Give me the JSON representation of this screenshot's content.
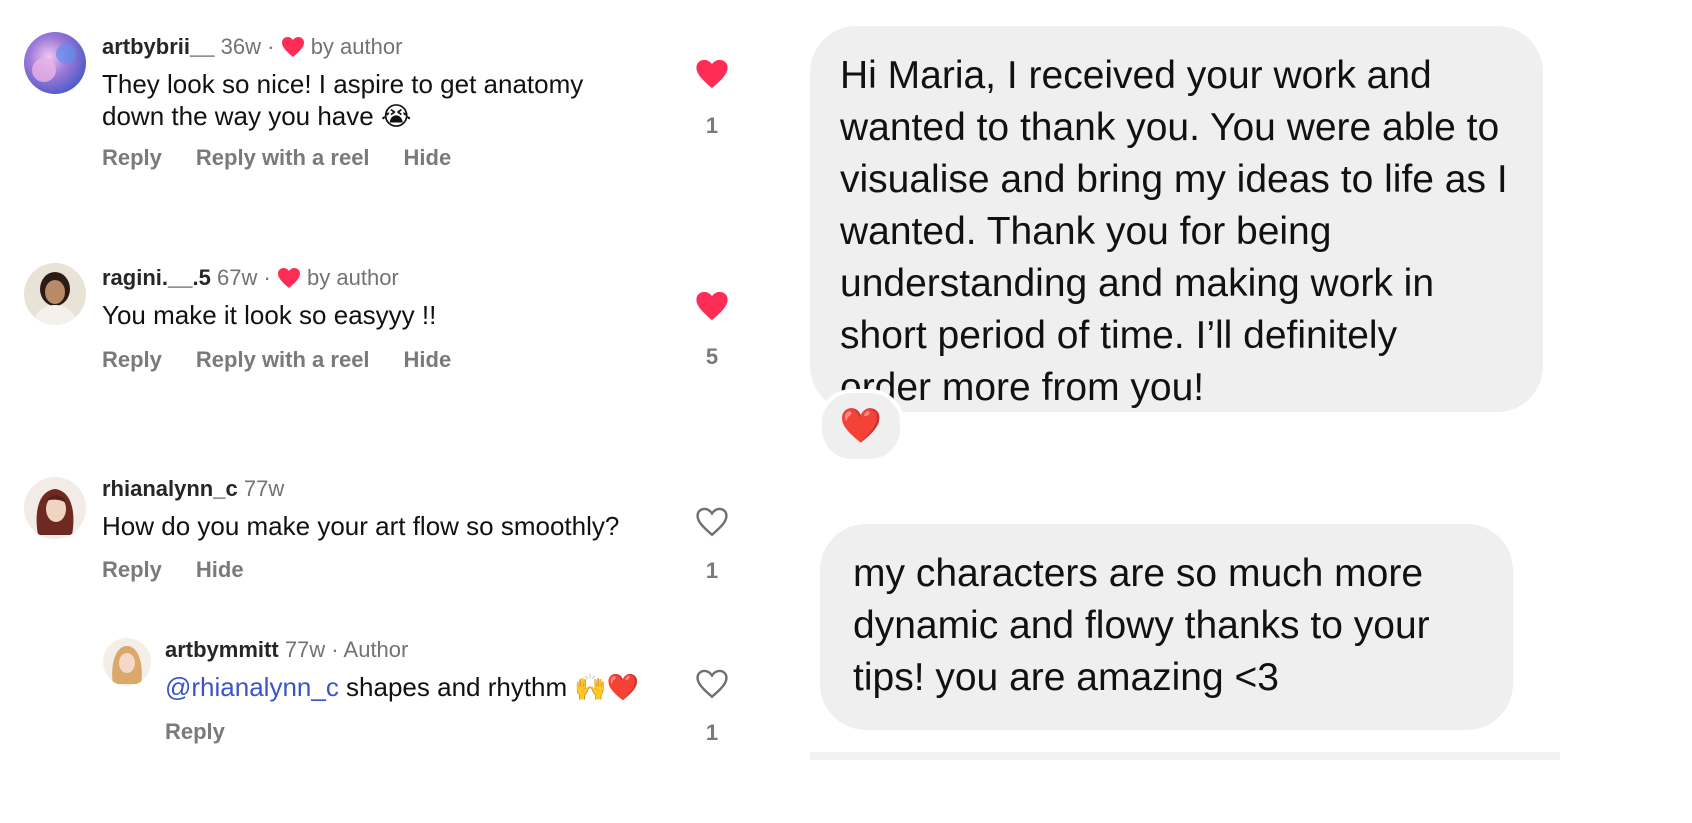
{
  "comments": [
    {
      "username": "artbybrii__",
      "time": "36w",
      "separator": "·",
      "liked_by": "by author",
      "text_line1": "They look so nice! I aspire to get anatomy",
      "text_line2": "down the way you have",
      "emoji": "😭",
      "actions": [
        "Reply",
        "Reply with a reel",
        "Hide"
      ],
      "likes": "1",
      "liked": true
    },
    {
      "username": "ragini.__.5",
      "time": "67w",
      "separator": "·",
      "liked_by": "by author",
      "text": "You make it look so easyyy !!",
      "actions": [
        "Reply",
        "Reply with a reel",
        "Hide"
      ],
      "likes": "5",
      "liked": true
    },
    {
      "username": "rhianalynn_c",
      "time": "77w",
      "text": "How do you make your art flow so smoothly?",
      "actions": [
        "Reply",
        "Hide"
      ],
      "likes": "1",
      "liked": false
    }
  ],
  "reply": {
    "username": "artbymmitt",
    "time": "77w",
    "separator": "·",
    "role": "Author",
    "mention": "@rhianalynn_c",
    "text": " shapes and rhythm",
    "emoji": "🙌❤️",
    "actions": [
      "Reply"
    ],
    "likes": "1",
    "liked": false
  },
  "messages": [
    {
      "lines": [
        "Hi Maria, I received your work and",
        "wanted to thank you. You were able to",
        "visualise and bring my ideas to life as I",
        "wanted. Thank you for being",
        "understanding and making work in",
        "short period of time. I’ll definitely",
        "order more from you!"
      ],
      "reaction": "❤️"
    },
    {
      "lines": [
        "my characters are so much more",
        "dynamic and flowy thanks to your",
        "tips! you are amazing <3"
      ]
    }
  ],
  "colors": {
    "like_red": "#ff2d55",
    "muted": "#737373",
    "mention": "#3b54c9",
    "bubble": "#efeff0"
  }
}
